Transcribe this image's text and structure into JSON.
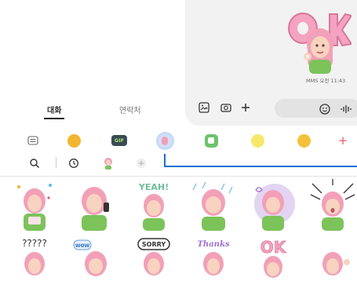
{
  "left_pane": {
    "tabs": [
      {
        "label": "대화",
        "active": true
      },
      {
        "label": "연락처",
        "active": false
      }
    ]
  },
  "chat": {
    "message_meta": "MMS 오전 11:43",
    "sent_sticker_icon": "ok-avatar-sticker",
    "toolbar": {
      "gallery_icon": "gallery-icon",
      "camera_icon": "camera-icon",
      "add_icon": "plus-icon",
      "emoji_icon": "emoji-icon",
      "voice_icon": "voice-waveform-icon"
    }
  },
  "categories": [
    {
      "name": "keyboard",
      "icon": "keyboard-icon"
    },
    {
      "name": "emoji",
      "icon": "emoji-face-icon"
    },
    {
      "name": "gif",
      "icon": "gif-icon",
      "label": "GIF"
    },
    {
      "name": "avatar",
      "icon": "avatar-sticker-icon",
      "active": true
    },
    {
      "name": "sticker-green",
      "icon": "sticker-pack-icon"
    },
    {
      "name": "sticker-sparkle",
      "icon": "sparkle-sticker-icon"
    },
    {
      "name": "sticker-face",
      "icon": "face-sticker-icon"
    },
    {
      "name": "add",
      "icon": "plus-icon",
      "label": "+"
    }
  ],
  "search_row": {
    "search_icon": "search-icon",
    "recent_icon": "clock-icon",
    "avatar_icon": "avatar-tab-icon",
    "add_icon": "add-circle-icon"
  },
  "sticker_grid": {
    "row1": [
      "birthday",
      "phone-call",
      "yeah",
      "rain",
      "daydream",
      "shock"
    ],
    "row2": [
      "confused",
      "wow",
      "sorry",
      "thanks",
      "ok",
      "wave"
    ],
    "texts": {
      "yeah": "YEAH!",
      "sorry": "SORRY",
      "thanks": "Thanks",
      "wow": "WOW",
      "ok": "OK",
      "confused": "?????"
    }
  },
  "colors": {
    "hair_pink": "#f2a0b8",
    "shirt_green": "#7cc35a",
    "accent_blue": "#1a6fd1",
    "chat_bg": "#f2f2f2",
    "input_bg": "#e3e3e3",
    "plus_red": "#e8576b"
  }
}
